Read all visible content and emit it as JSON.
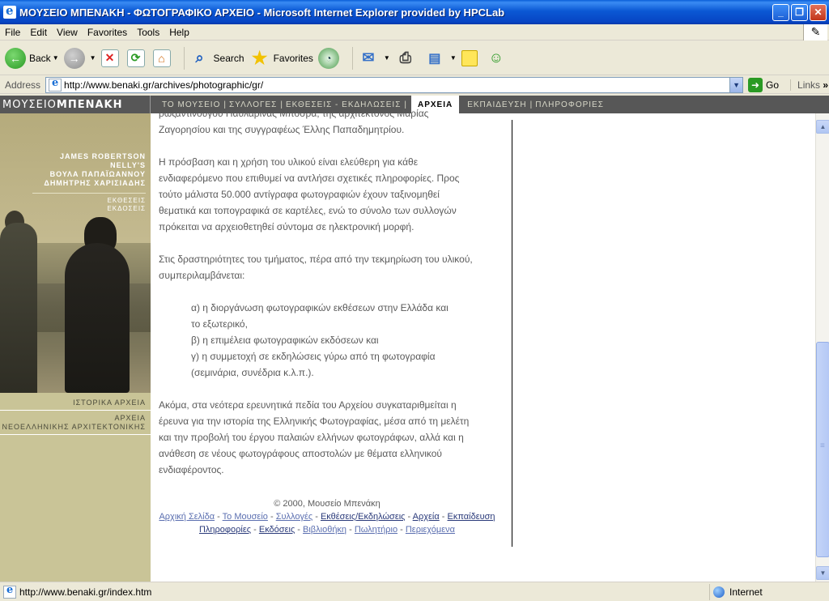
{
  "window": {
    "title": "ΜΟΥΣΕΙΟ ΜΠΕΝΑΚΗ - ΦΩΤΟΓΡΑΦΙΚΟ ΑΡΧΕΙΟ - Microsoft Internet Explorer provided by HPCLab",
    "minimize": "_",
    "restore": "❐",
    "close": "✕"
  },
  "menu": {
    "items": [
      "File",
      "Edit",
      "View",
      "Favorites",
      "Tools",
      "Help"
    ]
  },
  "toolbar": {
    "back_label": "Back",
    "search_label": "Search",
    "favorites_label": "Favorites"
  },
  "address": {
    "label": "Address",
    "url": "http://www.benaki.gr/archives/photographic/gr/",
    "go_label": "Go",
    "links_label": "Links"
  },
  "site": {
    "brand_light": "ΜΟΥΣΕΙΟ",
    "brand_bold": "ΜΠΕΝΑΚΗ",
    "nav": [
      "ΤΟ ΜΟΥΣΕΙΟ",
      "ΣΥΛΛΟΓΕΣ",
      "ΕΚΘΕΣΕΙΣ - ΕΚΔΗΛΩΣΕΙΣ",
      "ΑΡΧΕΙΑ",
      "ΕΚΠΑΙΔΕΥΣΗ",
      "ΠΛΗΡΟΦΟΡΙΕΣ"
    ],
    "left": {
      "caption_names": [
        "JAMES ROBERTSON",
        "NELLY'S",
        "ΒΟΥΛΑ ΠΑΠΑΪΩΑΝΝΟΥ",
        "ΔΗΜΗΤΡΗΣ ΧΑΡΙΣΙΑΔΗΣ"
      ],
      "caption_sub": [
        "ΕΚΘΕΣΕΙΣ",
        "ΕΚΔΟΣΕΙΣ"
      ],
      "link1": "ΙΣΤΟΡΙΚΑ ΑΡΧΕΙΑ",
      "link2_line1": "ΑΡΧΕΙΑ",
      "link2_line2": "ΝΕΟΕΛΛΗΝΙΚΗΣ ΑΡΧΙΤΕΚΤΟΝΙΚΗΣ"
    },
    "content": {
      "p0_line1": "ρωζαντινούγου Παυλαρίνας Μποσρα, της αρχιτέκτονος Μαρίας",
      "p0_line2": "Ζαγορησίου και της συγγραφέως Έλλης Παπαδημητρίου.",
      "p1": [
        "Η πρόσβαση και η χρήση του υλικού είναι ελεύθερη για κάθε",
        "ενδιαφερόμενο που επιθυμεί να αντλήσει σχετικές πληροφορίες. Προς",
        "τούτο μάλιστα 50.000 αντίγραφα φωτογραφιών έχουν ταξινομηθεί",
        "θεματικά και τοπογραφικά σε καρτέλες, ενώ το σύνολο των συλλογών",
        "πρόκειται να αρχειοθετηθεί σύντομα σε ηλεκτρονική μορφή."
      ],
      "p2": [
        "Στις δραστηριότητες του τμήματος, πέρα από την τεκμηρίωση του υλικού,",
        "συμπεριλαμβάνεται:"
      ],
      "list": [
        "α) η διοργάνωση φωτογραφικών εκθέσεων στην Ελλάδα και",
        "το εξωτερικό,",
        "β) η επιμέλεια φωτογραφικών εκδόσεων και",
        "γ) η συμμετοχή σε εκδηλώσεις γύρω από τη φωτογραφία",
        "(σεμινάρια, συνέδρια κ.λ.π.)."
      ],
      "p3": [
        "Ακόμα, στα νεότερα ερευνητικά πεδία του Αρχείου συγκαταριθμείται η",
        "έρευνα για την ιστορία της Ελληνικής Φωτογραφίας, μέσα από τη μελέτη",
        "και την προβολή του έργου παλαιών ελλήνων φωτογράφων, αλλά και η",
        "ανάθεση σε νέους φωτογράφους αποστολών με θέματα ελληνικού",
        "ενδιαφέροντος."
      ]
    },
    "footer": {
      "copyright": "© 2000, Μουσείο Μπενάκη",
      "links_row1": [
        "Αρχική Σελίδα",
        "Το Μουσείο",
        "Συλλογές",
        "Εκθέσεις/Εκδηλώσεις",
        "Αρχεία",
        "Εκπαίδευση"
      ],
      "links_row2": [
        "Πληροφορίες",
        "Εκδόσεις",
        "Βιβλιοθήκη",
        "Πωλητήριο",
        "Περιεχόμενα"
      ]
    }
  },
  "status": {
    "text": "http://www.benaki.gr/index.htm",
    "zone": "Internet"
  }
}
